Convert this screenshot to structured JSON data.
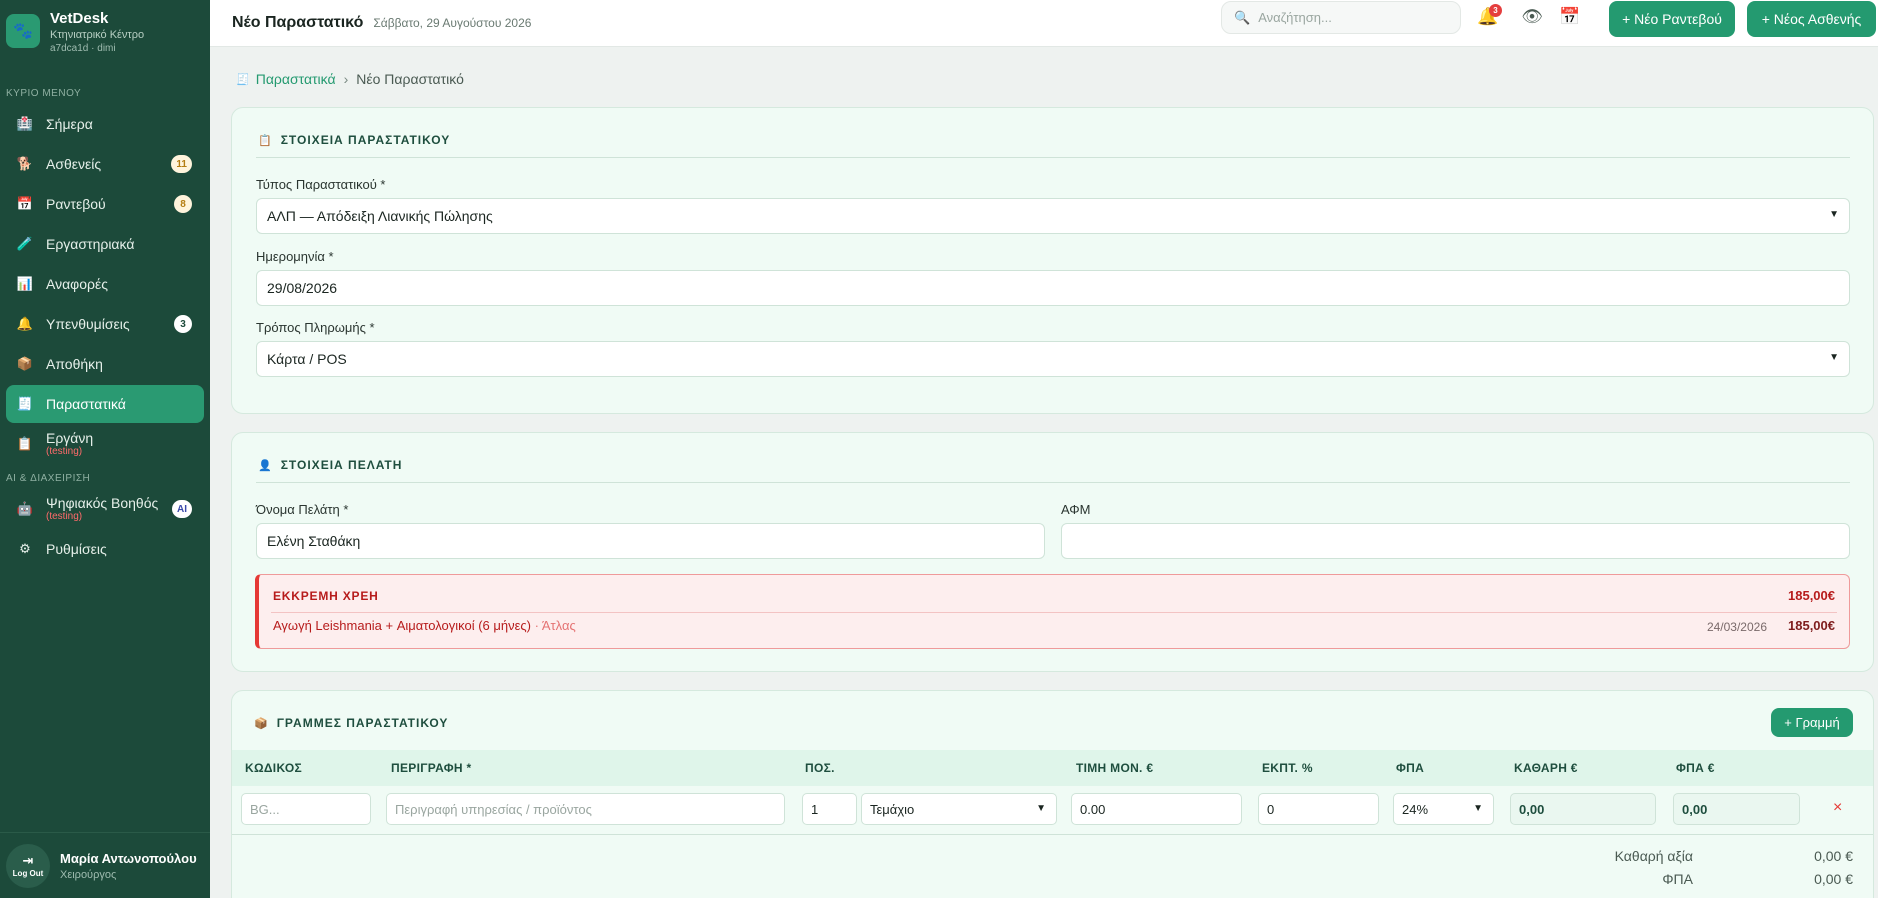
{
  "brand": {
    "name": "VetDesk",
    "subtitle": "Κτηνιατρικό Κέντρο",
    "meta": "a7dca1d · dimi"
  },
  "sidebar": {
    "section_main": "ΚΥΡΙΟ ΜΕΝΟΥ",
    "section_ai": "AI & ΔΙΑΧΕΙΡΙΣΗ",
    "items": [
      {
        "label": "Σήμερα",
        "icon": "🏥"
      },
      {
        "label": "Ασθενείς",
        "icon": "🐕",
        "badge": "11"
      },
      {
        "label": "Ραντεβού",
        "icon": "📅",
        "badge": "8"
      },
      {
        "label": "Εργαστηριακά",
        "icon": "🧪"
      },
      {
        "label": "Αναφορές",
        "icon": "📊"
      },
      {
        "label": "Υπενθυμίσεις",
        "icon": "🔔",
        "badge": "3"
      },
      {
        "label": "Αποθήκη",
        "icon": "📦"
      },
      {
        "label": "Παραστατικά",
        "icon": "🧾"
      },
      {
        "label": "Εργάνη",
        "icon": "📋",
        "note": "(testing)"
      },
      {
        "label": "Ψηφιακός Βοηθός",
        "icon": "🤖",
        "note": "(testing)",
        "badge": "AI"
      },
      {
        "label": "Ρυθμίσεις",
        "icon": "⚙"
      }
    ]
  },
  "user": {
    "name": "Μαρία Αντωνοπούλου",
    "role": "Χειρούργος",
    "logout": "Log Out"
  },
  "header": {
    "title": "Νέο Παραστατικό",
    "date": "Σάββατο, 29 Αυγούστου 2026",
    "search_placeholder": "Αναζήτηση...",
    "notif_count": "3",
    "btn_appointment": "+ Νέο Ραντεβού",
    "btn_patient": "+ Νέος Ασθενής"
  },
  "breadcrumb": {
    "parent": "Παραστατικά",
    "current": "Νέο Παραστατικό"
  },
  "doc_section": {
    "title": "ΣΤΟΙΧΕΙΑ ΠΑΡΑΣΤΑΤΙΚΟΥ",
    "type_label": "Τύπος Παραστατικού *",
    "type_value": "ΑΛΠ — Απόδειξη Λιανικής Πώλησης",
    "date_label": "Ημερομηνία *",
    "date_value": "29/08/2026",
    "payment_label": "Τρόπος Πληρωμής *",
    "payment_value": "Κάρτα / POS"
  },
  "client_section": {
    "title": "ΣΤΟΙΧΕΙΑ ΠΕΛΑΤΗ",
    "name_label": "Όνομα Πελάτη *",
    "name_value": "Ελένη Σταθάκη",
    "afm_label": "ΑΦΜ",
    "afm_value": ""
  },
  "debts": {
    "title": "ΕΚΚΡΕΜΗ ΧΡΕΗ",
    "total": "185,00€",
    "items": [
      {
        "desc": "Αγωγή Leishmania + Αιματολογικοί (6 μήνες)",
        "pet": " · Άτλας",
        "date": "24/03/2026",
        "amount": "185,00€"
      }
    ]
  },
  "lines_section": {
    "title": "ΓΡΑΜΜΕΣ ΠΑΡΑΣΤΑΤΙΚΟΥ",
    "add_button": "+ Γραμμή",
    "columns": [
      "ΚΩΔΙΚΟΣ",
      "ΠΕΡΙΓΡΑΦΗ *",
      "ΠΟΣ.",
      "ΤΙΜΗ ΜΟΝ. €",
      "ΕΚΠΤ. %",
      "ΦΠΑ",
      "ΚΑΘΑΡΗ €",
      "ΦΠΑ €"
    ],
    "row": {
      "code_placeholder": "BG...",
      "desc_placeholder": "Περιγραφή υπηρεσίας / προϊόντος",
      "qty": "1",
      "unit": "Τεμάχιο",
      "price": "0.00",
      "discount": "0",
      "vat": "24%",
      "net": "0,00",
      "vat_amount": "0,00",
      "delete": "×"
    },
    "totals": [
      {
        "label": "Καθαρή αξία",
        "value": "0,00 €"
      },
      {
        "label": "ΦΠΑ",
        "value": "0,00 €"
      }
    ]
  }
}
